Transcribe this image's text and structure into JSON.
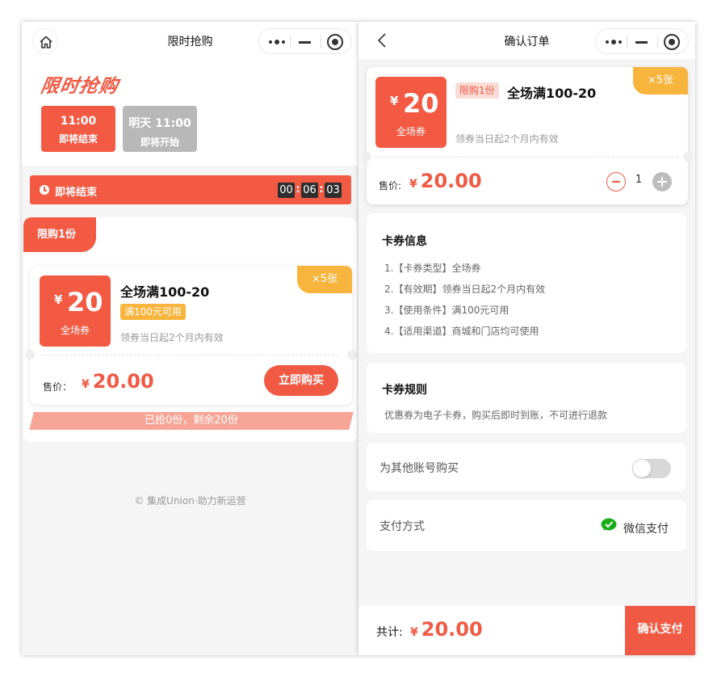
{
  "left": {
    "nav_title": "限时抢购",
    "promo_title": "限时抢购",
    "slots": [
      {
        "time": "11:00",
        "status": "即将结束"
      },
      {
        "time": "明天 11:00",
        "status": "即将开始"
      }
    ],
    "countdown": {
      "label": "即将结束",
      "hh": "00",
      "mm": "06",
      "ss": "03",
      "sep": ":"
    },
    "limit_tab": "限购1份",
    "coupon": {
      "yen": "¥",
      "amount": "20",
      "kind": "全场券",
      "qty": "×5张",
      "name": "全场满100-20",
      "condition": "满100元可用",
      "validity": "领券当日起2个月内有效",
      "price_label": "售价：",
      "price_yen": "¥",
      "price": "20.00",
      "buy_label": "立即购买"
    },
    "sold_text": "已抢0份，剩余20份",
    "credit": "© 集成Union·助力新运营"
  },
  "right": {
    "nav_title": "确认订单",
    "coupon": {
      "yen": "¥",
      "amount": "20",
      "kind": "全场券",
      "qty": "×5张",
      "limit": "限购1份",
      "name": "全场满100-20",
      "validity": "领券当日起2个月内有效",
      "price_label": "售价:",
      "price_yen": "¥",
      "price": "20.00",
      "quantity": "1"
    },
    "info": {
      "title": "卡券信息",
      "lines": [
        "1.【卡券类型】全场券",
        "2.【有效期】领券当日起2个月内有效",
        "3.【使用条件】满100元可用",
        "4.【适用渠道】商城和门店均可使用"
      ]
    },
    "rules": {
      "title": "卡券规则",
      "text": "优惠券为电子卡券，购买后即时到账，不可进行退款"
    },
    "other_account": {
      "label": "为其他账号购买",
      "enabled": false
    },
    "payment": {
      "label": "支付方式",
      "value": "微信支付"
    },
    "total": {
      "label": "共计:",
      "yen": "¥",
      "value": "20.00"
    },
    "confirm_label": "确认支付"
  },
  "colors": {
    "accent": "#f05a44",
    "tag": "#f8b53e",
    "disabled": "#b8b8b8",
    "wechat": "#1aad19"
  },
  "icons": [
    "home-icon",
    "more-dots-icon",
    "minimize-icon",
    "close-circle-icon",
    "back-icon",
    "clock-icon",
    "wechat-pay-icon"
  ]
}
